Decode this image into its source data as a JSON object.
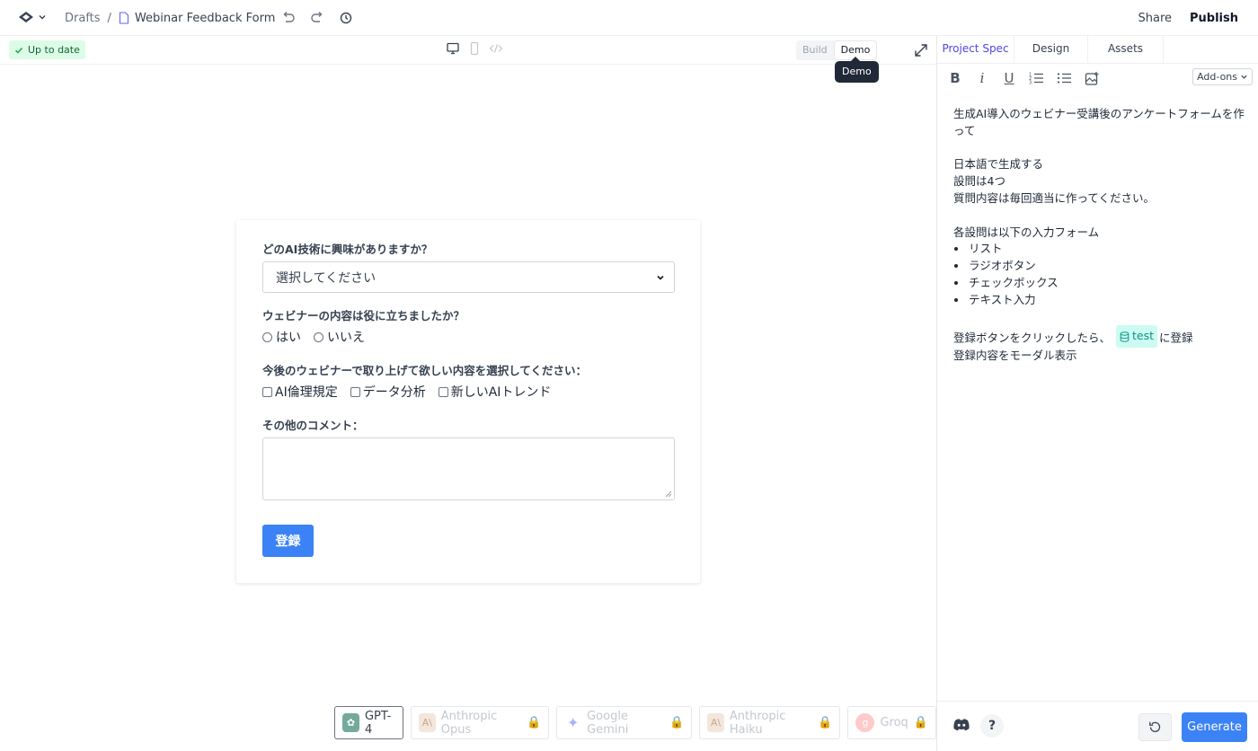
{
  "header": {
    "breadcrumb_root": "Drafts",
    "breadcrumb_sep": "/",
    "file_title": "Webinar Feedback Form",
    "share_label": "Share",
    "publish_label": "Publish"
  },
  "canvas_bar": {
    "status": "Up to date",
    "mode_build": "Build",
    "mode_demo": "Demo",
    "tooltip": "Demo"
  },
  "form": {
    "q1": "どのAI技術に興味がありますか？",
    "q1_select_value": "選択してください",
    "q2": "ウェビナーの内容は役に立ちましたか？",
    "q2_options": [
      "はい",
      "いいえ"
    ],
    "q3": "今後のウェビナーで取り上げて欲しい内容を選択してください：",
    "q3_options": [
      "AI倫理規定",
      "データ分析",
      "新しいAIトレンド"
    ],
    "q4": "その他のコメント：",
    "submit_label": "登録"
  },
  "models": [
    {
      "label": "GPT-4",
      "active": true
    },
    {
      "label": "Anthropic Opus",
      "active": false
    },
    {
      "label": "Google Gemini",
      "active": false
    },
    {
      "label": "Anthropic Haiku",
      "active": false
    },
    {
      "label": "Groq",
      "active": false
    }
  ],
  "panel": {
    "tabs": [
      "Project Spec",
      "Design",
      "Assets"
    ],
    "addons_label": "Add-ons",
    "spec": {
      "line1": "生成AI導入のウェビナー受講後のアンケートフォームを作って",
      "line2": "日本語で生成する",
      "line3": "設問は4つ",
      "line4": "質問内容は毎回適当に作ってください。",
      "line5": "各設問は以下の入力フォーム",
      "bullets": [
        "リスト",
        "ラジオボタン",
        "チェックボックス",
        "テキスト入力"
      ],
      "line6_pre": "登録ボタンをクリックしたら、",
      "chip": "test",
      "line6_post": "に登録",
      "line7": "登録内容をモーダル表示"
    },
    "help_label": "?",
    "generate_label": "Generate"
  },
  "colors": {
    "accent": "#3b82f6",
    "tab_active": "#4f46e5",
    "status_bg": "#dcfce7",
    "chip_bg": "#ccfbf1"
  }
}
